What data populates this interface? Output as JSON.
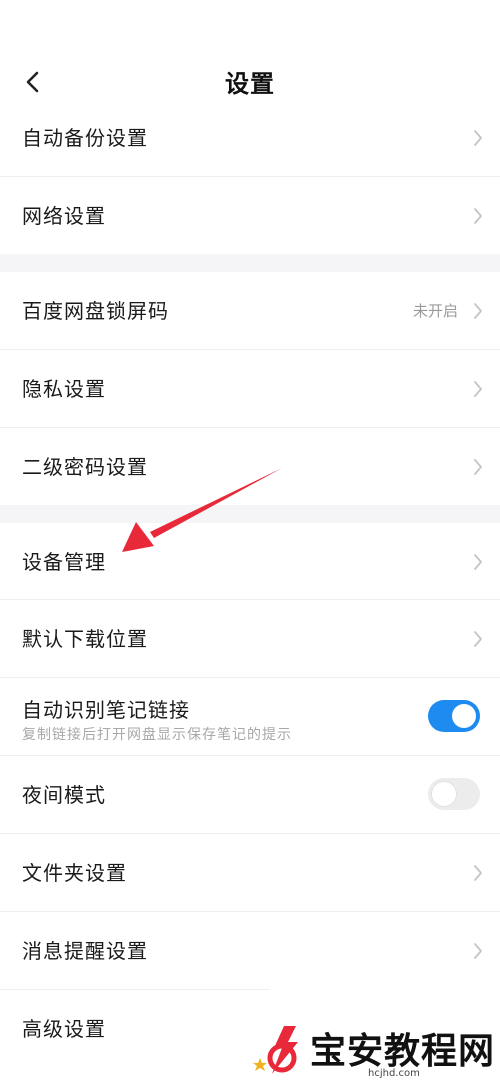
{
  "header": {
    "title": "设置"
  },
  "sections": {
    "row_auto_backup": {
      "label": "自动备份设置"
    },
    "row_network": {
      "label": "网络设置"
    },
    "row_lockscreen": {
      "label": "百度网盘锁屏码",
      "status": "未开启"
    },
    "row_privacy": {
      "label": "隐私设置"
    },
    "row_secondary_password": {
      "label": "二级密码设置"
    },
    "row_device_management": {
      "label": "设备管理"
    },
    "row_download_location": {
      "label": "默认下载位置"
    },
    "row_note_link": {
      "label": "自动识别笔记链接",
      "description": "复制链接后打开网盘显示保存笔记的提示",
      "enabled": true
    },
    "row_night_mode": {
      "label": "夜间模式",
      "enabled": false
    },
    "row_folder": {
      "label": "文件夹设置"
    },
    "row_notification": {
      "label": "消息提醒设置"
    },
    "row_advanced": {
      "label": "高级设置"
    }
  },
  "watermark": {
    "text": "宝安教程网",
    "site": "hcjhd.com"
  },
  "colors": {
    "accent": "#1e8bf0",
    "annotation": "#e8293a"
  },
  "icons": {
    "back": "chevron-left-icon",
    "row_arrow": "chevron-right-icon"
  }
}
